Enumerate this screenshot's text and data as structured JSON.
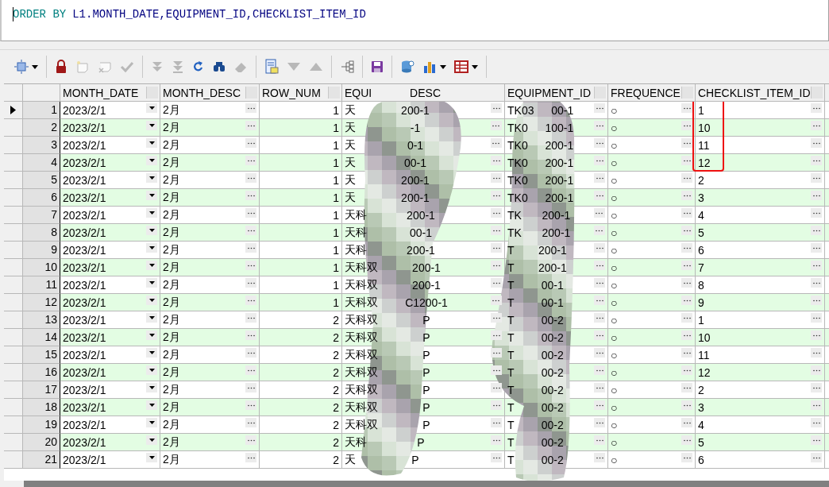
{
  "editor": {
    "tokens": [
      {
        "kind": "keyword",
        "text": "ORDER BY"
      },
      {
        "kind": "ident",
        "text": "L1.MONTH_DATE,EQUIPMENT_ID,CHECKLIST_ITEM_ID"
      }
    ]
  },
  "toolbar": {
    "groups": [
      [
        {
          "kind": "frame",
          "disabled": false,
          "menu": true
        }
      ],
      [
        {
          "kind": "lock",
          "disabled": false,
          "menu": false
        },
        {
          "kind": "new-record",
          "disabled": true,
          "menu": false
        },
        {
          "kind": "delete-record",
          "disabled": true,
          "menu": false
        },
        {
          "kind": "check",
          "disabled": true,
          "menu": false
        }
      ],
      [
        {
          "kind": "last",
          "disabled": true,
          "menu": false
        },
        {
          "kind": "fetch-all",
          "disabled": true,
          "menu": false
        },
        {
          "kind": "refresh",
          "disabled": false,
          "menu": false
        },
        {
          "kind": "find",
          "disabled": false,
          "menu": false
        },
        {
          "kind": "clear",
          "disabled": true,
          "menu": false
        }
      ],
      [
        {
          "kind": "form",
          "disabled": false,
          "menu": false
        },
        {
          "kind": "down",
          "disabled": true,
          "menu": false
        },
        {
          "kind": "up",
          "disabled": true,
          "menu": false
        }
      ],
      [
        {
          "kind": "tree",
          "disabled": false,
          "menu": false
        }
      ],
      [
        {
          "kind": "save",
          "disabled": false,
          "menu": false
        }
      ],
      [
        {
          "kind": "export",
          "disabled": false,
          "menu": false
        },
        {
          "kind": "chart",
          "disabled": false,
          "menu": true
        },
        {
          "kind": "grid",
          "disabled": false,
          "menu": true
        }
      ]
    ]
  },
  "grid": {
    "columns": [
      "MONTH_DATE",
      "MONTH_DESC",
      "ROW_NUM",
      "EQUI",
      "DESC",
      "EQUIPMENT_ID",
      "FREQUENCE",
      "CHECKLIST_ITEM_ID"
    ],
    "rows": [
      {
        "n": "1",
        "current": true,
        "month_date": "2023/2/1",
        "month_desc": "2月",
        "row_num": "1",
        "desc_start": "天",
        "desc_end": "200-1",
        "id_start": "TK03",
        "id_end": "00-1",
        "frequence": "○",
        "item": "1",
        "highlighted": true
      },
      {
        "n": "2",
        "current": false,
        "month_date": "2023/2/1",
        "month_desc": "2月",
        "row_num": "1",
        "desc_start": "天",
        "desc_end": "-1",
        "id_start": "TK0",
        "id_end": "100-1",
        "frequence": "○",
        "item": "10",
        "highlighted": true
      },
      {
        "n": "3",
        "current": false,
        "month_date": "2023/2/1",
        "month_desc": "2月",
        "row_num": "1",
        "desc_start": "天",
        "desc_end": "0-1",
        "id_start": "TK0",
        "id_end": "200-1",
        "frequence": "○",
        "item": "11",
        "highlighted": true
      },
      {
        "n": "4",
        "current": false,
        "month_date": "2023/2/1",
        "month_desc": "2月",
        "row_num": "1",
        "desc_start": "天",
        "desc_end": "00-1",
        "id_start": "TK0",
        "id_end": "200-1",
        "frequence": "○",
        "item": "12",
        "highlighted": true
      },
      {
        "n": "5",
        "current": false,
        "month_date": "2023/2/1",
        "month_desc": "2月",
        "row_num": "1",
        "desc_start": "天",
        "desc_end": "200-1",
        "id_start": "TK0",
        "id_end": "200-1",
        "frequence": "○",
        "item": "2",
        "highlighted": false
      },
      {
        "n": "6",
        "current": false,
        "month_date": "2023/2/1",
        "month_desc": "2月",
        "row_num": "1",
        "desc_start": "天",
        "desc_end": "200-1",
        "id_start": "TK0",
        "id_end": "200-1",
        "frequence": "○",
        "item": "3",
        "highlighted": false
      },
      {
        "n": "7",
        "current": false,
        "month_date": "2023/2/1",
        "month_desc": "2月",
        "row_num": "1",
        "desc_start": "天科",
        "desc_end": "200-1",
        "id_start": "TK",
        "id_end": "200-1",
        "frequence": "○",
        "item": "4",
        "highlighted": false
      },
      {
        "n": "8",
        "current": false,
        "month_date": "2023/2/1",
        "month_desc": "2月",
        "row_num": "1",
        "desc_start": "天科",
        "desc_end": "00-1",
        "id_start": "TK",
        "id_end": "200-1",
        "frequence": "○",
        "item": "5",
        "highlighted": false
      },
      {
        "n": "9",
        "current": false,
        "month_date": "2023/2/1",
        "month_desc": "2月",
        "row_num": "1",
        "desc_start": "天科",
        "desc_end": "200-1",
        "id_start": "T",
        "id_end": "200-1",
        "frequence": "○",
        "item": "6",
        "highlighted": false
      },
      {
        "n": "10",
        "current": false,
        "month_date": "2023/2/1",
        "month_desc": "2月",
        "row_num": "1",
        "desc_start": "天科双",
        "desc_end": "200-1",
        "id_start": "T",
        "id_end": "200-1",
        "frequence": "○",
        "item": "7",
        "highlighted": false
      },
      {
        "n": "11",
        "current": false,
        "month_date": "2023/2/1",
        "month_desc": "2月",
        "row_num": "1",
        "desc_start": "天科双",
        "desc_end": "200-1",
        "id_start": "T",
        "id_end": "00-1",
        "frequence": "○",
        "item": "8",
        "highlighted": false
      },
      {
        "n": "12",
        "current": false,
        "month_date": "2023/2/1",
        "month_desc": "2月",
        "row_num": "1",
        "desc_start": "天科双",
        "desc_end": "C1200-1",
        "id_start": "T",
        "id_end": "00-1",
        "frequence": "○",
        "item": "9",
        "highlighted": false
      },
      {
        "n": "13",
        "current": false,
        "month_date": "2023/2/1",
        "month_desc": "2月",
        "row_num": "2",
        "desc_start": "天科双",
        "desc_end": "P",
        "id_start": "T",
        "id_end": "00-2",
        "frequence": "○",
        "item": "1",
        "highlighted": false
      },
      {
        "n": "14",
        "current": false,
        "month_date": "2023/2/1",
        "month_desc": "2月",
        "row_num": "2",
        "desc_start": "天科双",
        "desc_end": "P",
        "id_start": "T",
        "id_end": "00-2",
        "frequence": "○",
        "item": "10",
        "highlighted": false
      },
      {
        "n": "15",
        "current": false,
        "month_date": "2023/2/1",
        "month_desc": "2月",
        "row_num": "2",
        "desc_start": "天科双",
        "desc_end": "P",
        "id_start": "T",
        "id_end": "00-2",
        "frequence": "○",
        "item": "11",
        "highlighted": false
      },
      {
        "n": "16",
        "current": false,
        "month_date": "2023/2/1",
        "month_desc": "2月",
        "row_num": "2",
        "desc_start": "天科双",
        "desc_end": "P",
        "id_start": "T",
        "id_end": "00-2",
        "frequence": "○",
        "item": "12",
        "highlighted": false
      },
      {
        "n": "17",
        "current": false,
        "month_date": "2023/2/1",
        "month_desc": "2月",
        "row_num": "2",
        "desc_start": "天科双",
        "desc_end": "P",
        "id_start": "T",
        "id_end": "00-2",
        "frequence": "○",
        "item": "2",
        "highlighted": false
      },
      {
        "n": "18",
        "current": false,
        "month_date": "2023/2/1",
        "month_desc": "2月",
        "row_num": "2",
        "desc_start": "天科双",
        "desc_end": "P",
        "id_start": "T",
        "id_end": "00-2",
        "frequence": "○",
        "item": "3",
        "highlighted": false
      },
      {
        "n": "19",
        "current": false,
        "month_date": "2023/2/1",
        "month_desc": "2月",
        "row_num": "2",
        "desc_start": "天科双",
        "desc_end": "P",
        "id_start": "T",
        "id_end": "00-2",
        "frequence": "○",
        "item": "4",
        "highlighted": false
      },
      {
        "n": "20",
        "current": false,
        "month_date": "2023/2/1",
        "month_desc": "2月",
        "row_num": "2",
        "desc_start": "天科",
        "desc_end": "P",
        "id_start": "T",
        "id_end": "00-2",
        "frequence": "○",
        "item": "5",
        "highlighted": false
      },
      {
        "n": "21",
        "current": false,
        "month_date": "2023/2/1",
        "month_desc": "2月",
        "row_num": "2",
        "desc_start": "天",
        "desc_end": "P",
        "id_start": "T",
        "id_end": "00-2",
        "frequence": "○",
        "item": "6",
        "highlighted": false
      }
    ]
  }
}
